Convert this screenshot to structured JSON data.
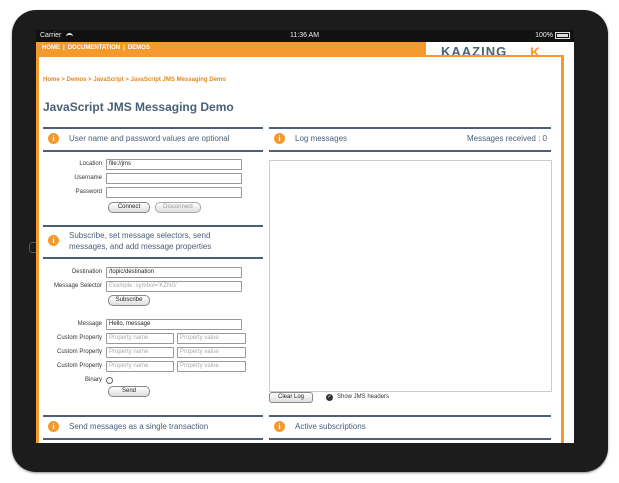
{
  "status_bar": {
    "carrier": "Carrier",
    "time": "11:36 AM",
    "battery": "100%"
  },
  "nav": {
    "items": [
      "HOME",
      "|",
      "DOCUMENTATION",
      "|",
      "DEMOS"
    ]
  },
  "logo": {
    "text": "KAAZING",
    "mark": "K"
  },
  "breadcrumb": "Home > Demos > JavaScript > JavaScript JMS Messaging Demo",
  "page_title": "JavaScript JMS Messaging Demo",
  "panels": {
    "credentials": "User name and password values are optional",
    "subscribe_line1": "Subscribe, set message selectors, send",
    "subscribe_line2": "messages, and add message properties",
    "transaction": "Send messages as a single transaction",
    "log": "Log messages",
    "log_count": "Messages received : 0",
    "subscriptions": "Active subscriptions"
  },
  "connect_form": {
    "location_label": "Location",
    "location_value": "file://jms",
    "username_label": "Username",
    "username_value": "",
    "password_label": "Password",
    "password_value": "",
    "connect": "Connect",
    "disconnect": "Disconnect"
  },
  "subscribe_form": {
    "destination_label": "Destination",
    "destination_value": "/topic/destination",
    "selector_label": "Message Selector",
    "selector_placeholder": "Example: symbol='KZNG'",
    "subscribe": "Subscribe",
    "message_label": "Message",
    "message_value": "Hello, message",
    "prop_label": "Custom Property",
    "prop_name_placeholder": "Property name",
    "prop_value_placeholder": "Property value",
    "binary_label": "Binary",
    "send": "Send"
  },
  "log_controls": {
    "clear": "Clear Log",
    "show_headers": "Show JMS headers"
  },
  "icons": {
    "info": "i",
    "check": "✓"
  },
  "colors": {
    "accent": "#f29a2e",
    "heading": "#4a6079"
  }
}
